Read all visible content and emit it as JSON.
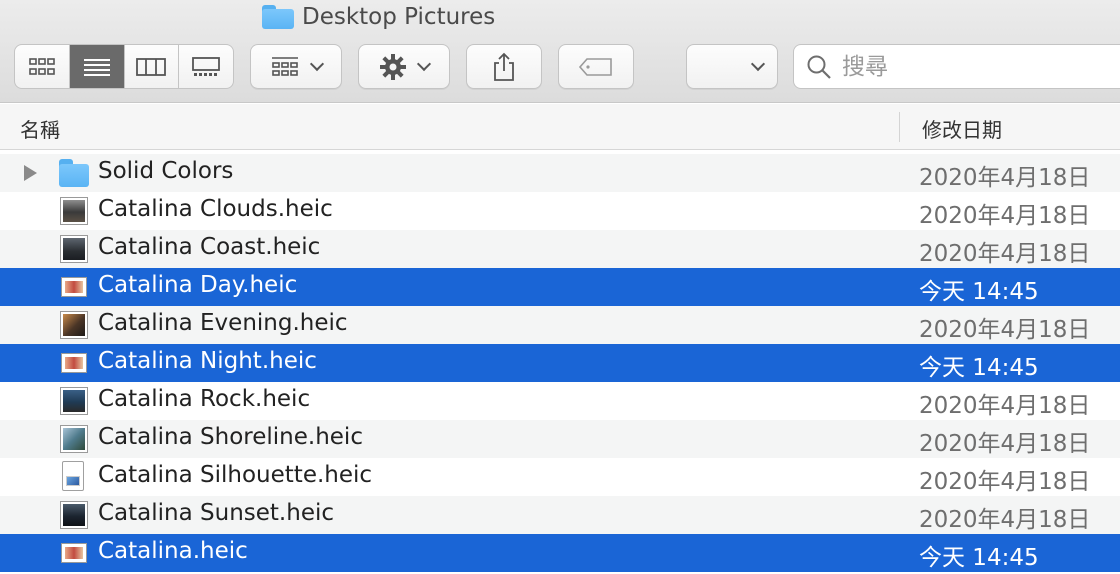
{
  "window": {
    "title": "Desktop Pictures",
    "title_icon": "folder-icon"
  },
  "toolbar": {
    "view_modes": [
      {
        "name": "icon-view",
        "icon": "grid-icon",
        "active": false
      },
      {
        "name": "list-view",
        "icon": "list-icon",
        "active": true
      },
      {
        "name": "column-view",
        "icon": "columns-icon",
        "active": false
      },
      {
        "name": "gallery-view",
        "icon": "gallery-icon",
        "active": false
      }
    ],
    "group_icon": "group-icon",
    "action_icon": "gear-icon",
    "share_icon": "share-icon",
    "tag_icon": "tag-icon",
    "path_dropdown_value": "",
    "search_placeholder": "搜尋"
  },
  "columns": {
    "name": "名稱",
    "date_modified": "修改日期"
  },
  "colors": {
    "selection": "#1a65d6",
    "folder": "#5ab4f4"
  },
  "files": [
    {
      "name": "Solid Colors",
      "date": "2020年4月18日",
      "kind": "folder",
      "selected": false
    },
    {
      "name": "Catalina Clouds.heic",
      "date": "2020年4月18日",
      "kind": "image",
      "selected": false
    },
    {
      "name": "Catalina Coast.heic",
      "date": "2020年4月18日",
      "kind": "image",
      "selected": false
    },
    {
      "name": "Catalina Day.heic",
      "date": "今天 14:45",
      "kind": "image",
      "selected": true
    },
    {
      "name": "Catalina Evening.heic",
      "date": "2020年4月18日",
      "kind": "image",
      "selected": false
    },
    {
      "name": "Catalina Night.heic",
      "date": "今天 14:45",
      "kind": "image",
      "selected": true
    },
    {
      "name": "Catalina Rock.heic",
      "date": "2020年4月18日",
      "kind": "image",
      "selected": false
    },
    {
      "name": "Catalina Shoreline.heic",
      "date": "2020年4月18日",
      "kind": "image",
      "selected": false
    },
    {
      "name": "Catalina Silhouette.heic",
      "date": "2020年4月18日",
      "kind": "document",
      "selected": false
    },
    {
      "name": "Catalina Sunset.heic",
      "date": "2020年4月18日",
      "kind": "image",
      "selected": false
    },
    {
      "name": "Catalina.heic",
      "date": "今天 14:45",
      "kind": "image",
      "selected": true
    }
  ]
}
